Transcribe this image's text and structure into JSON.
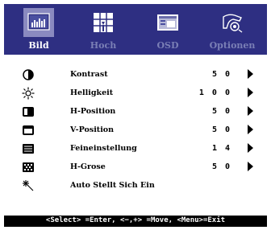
{
  "colors": {
    "header_bg": "#2e2f82",
    "active_tab_bg": "#8a8ac0",
    "inactive_label": "#7a7fb5",
    "active_label": "#ffffff",
    "footer_bg": "#000000",
    "footer_text": "#ffffff"
  },
  "tabs": [
    {
      "label": "Bild",
      "icon": "picture-icon",
      "active": true
    },
    {
      "label": "Hoch",
      "icon": "advanced-grid-icon",
      "active": false
    },
    {
      "label": "OSD",
      "icon": "osd-window-icon",
      "active": false
    },
    {
      "label": "Optionen",
      "icon": "options-hand-icon",
      "active": false
    }
  ],
  "rows": [
    {
      "label": "Kontrast",
      "value": "5 0",
      "icon": "contrast-icon",
      "has_arrow": true
    },
    {
      "label": "Helligkeit",
      "value": "1 0 0",
      "icon": "brightness-icon",
      "has_arrow": true
    },
    {
      "label": "H-Position",
      "value": "5 0",
      "icon": "h-position-icon",
      "has_arrow": true
    },
    {
      "label": "V-Position",
      "value": "5 0",
      "icon": "v-position-icon",
      "has_arrow": true
    },
    {
      "label": "Feineinstellung",
      "value": "1 4",
      "icon": "fine-tune-icon",
      "has_arrow": true
    },
    {
      "label": "H-Grose",
      "value": "5 0",
      "icon": "h-size-icon",
      "has_arrow": true
    },
    {
      "label": "Auto Stellt Sich Ein",
      "value": "",
      "icon": "auto-adjust-icon",
      "has_arrow": false
    }
  ],
  "footer": {
    "help": "<Select> =Enter, <−,+> =Move, <Menu>=Exit"
  }
}
